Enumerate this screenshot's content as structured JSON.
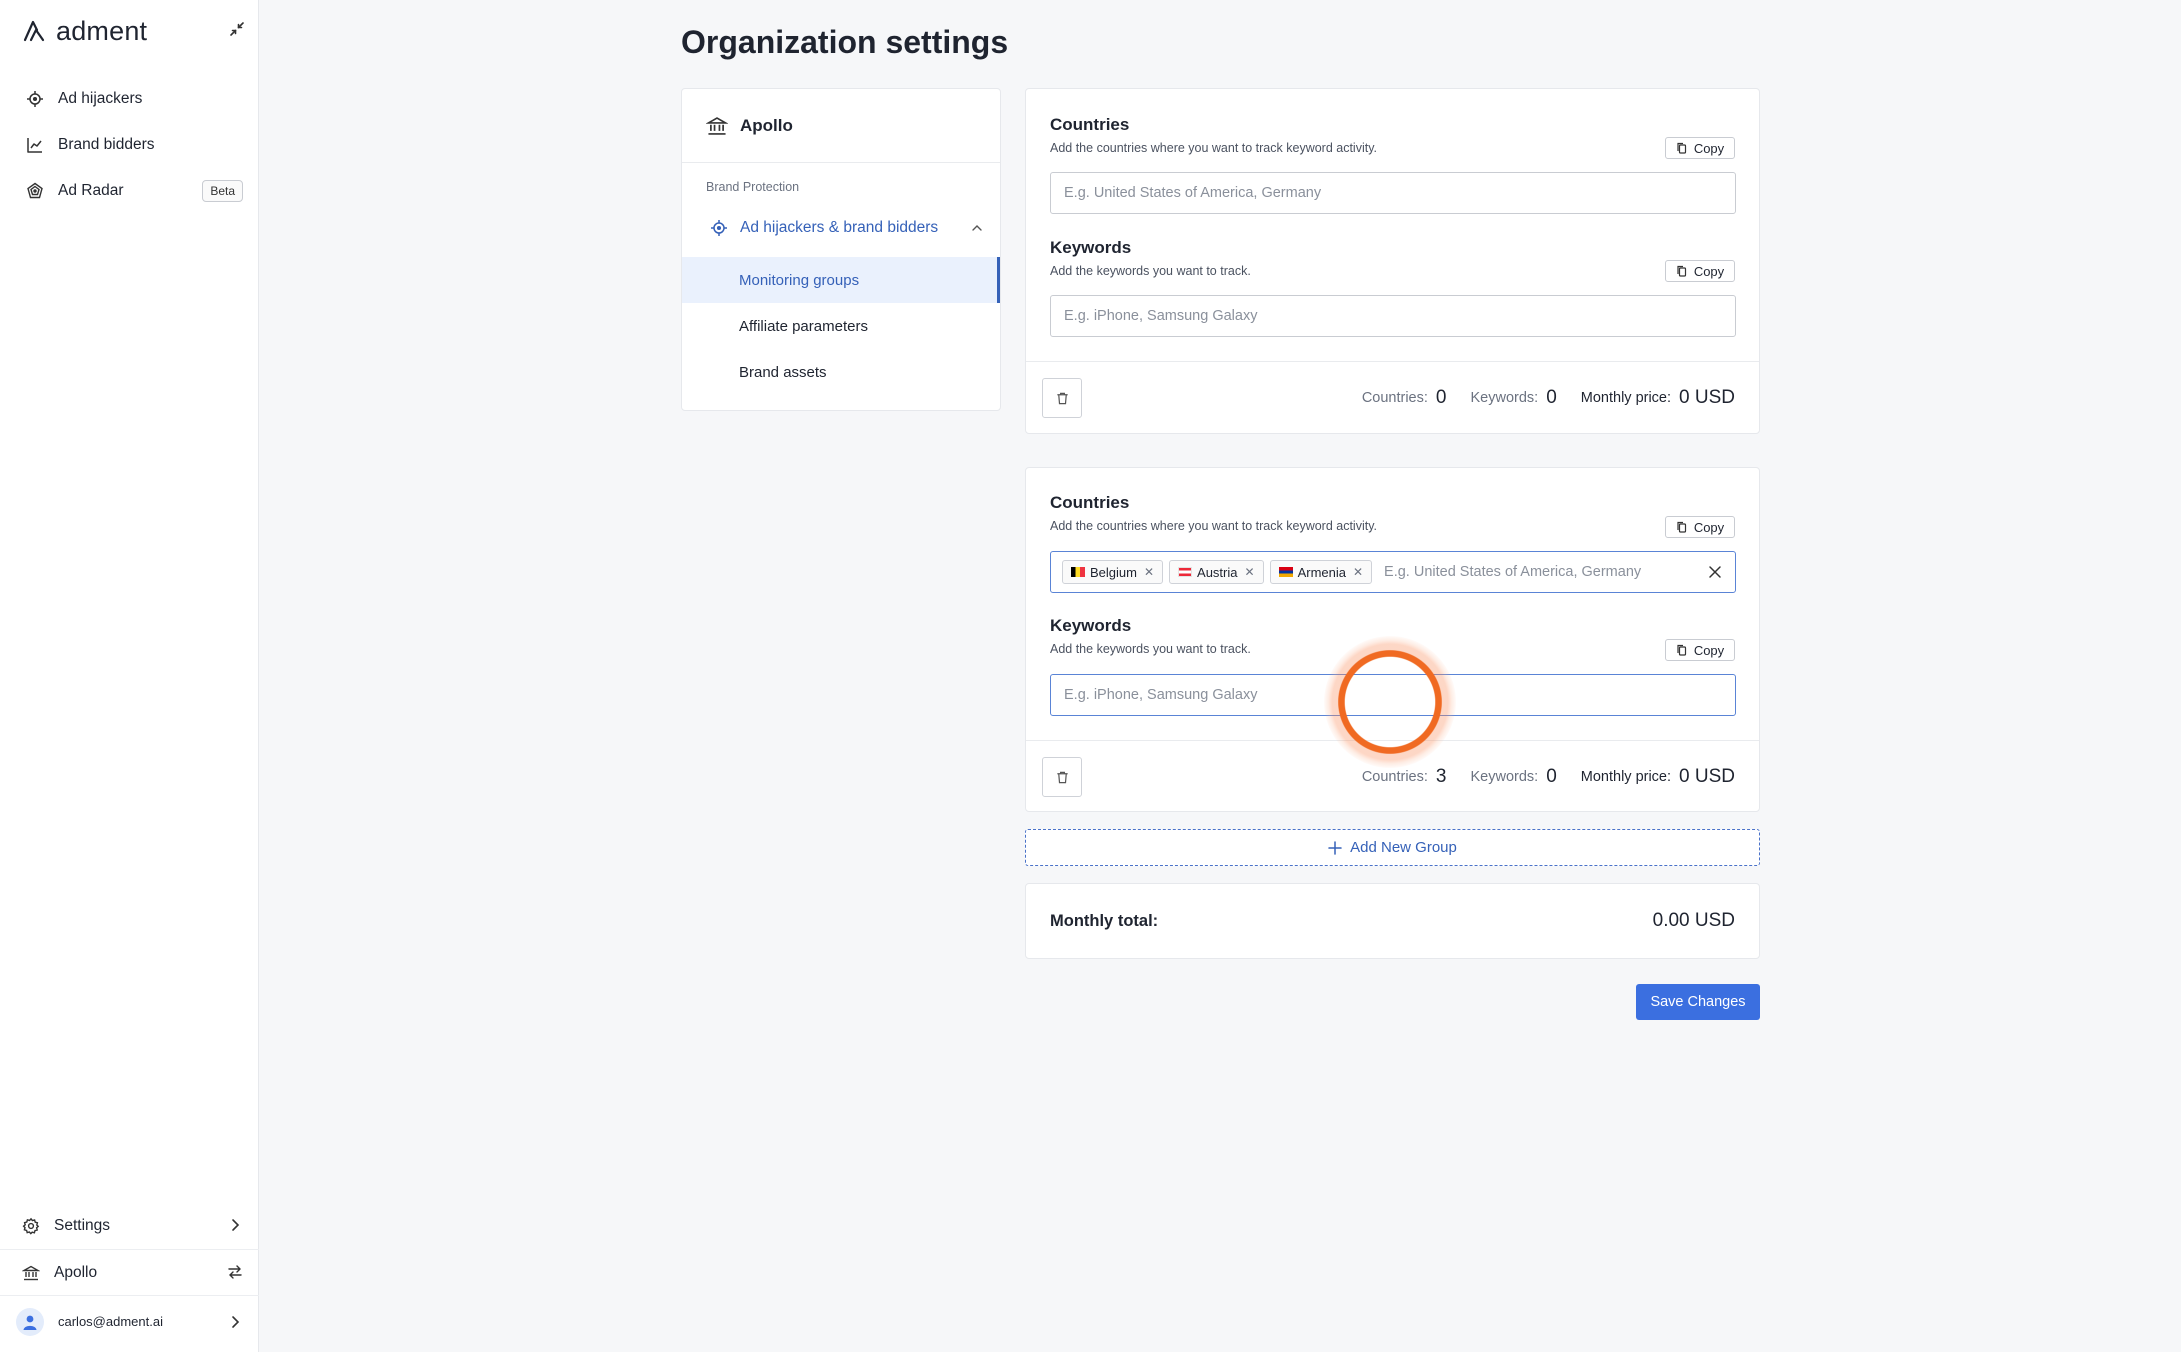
{
  "app": {
    "name": "adment"
  },
  "sidebar": {
    "nav": [
      {
        "label": "Ad hijackers",
        "icon": "crosshair-icon"
      },
      {
        "label": "Brand bidders",
        "icon": "line-chart-icon"
      },
      {
        "label": "Ad Radar",
        "icon": "radar-icon",
        "badge": "Beta"
      }
    ],
    "settings_label": "Settings",
    "org_label": "Apollo",
    "user_email": "carlos@adment.ai"
  },
  "page": {
    "title": "Organization settings"
  },
  "settings_nav": {
    "org_name": "Apollo",
    "section_label": "Brand Protection",
    "parent_item": "Ad hijackers & brand bidders",
    "sub_items": [
      "Monitoring groups",
      "Affiliate parameters",
      "Brand assets"
    ],
    "active_sub_item": "Monitoring groups"
  },
  "groups": [
    {
      "countries_title": "Countries",
      "countries_desc": "Add the countries where you want to track keyword activity.",
      "countries_placeholder": "E.g. United States of America, Germany",
      "countries_value": "",
      "countries_tags": [],
      "keywords_title": "Keywords",
      "keywords_desc": "Add the keywords you want to track.",
      "keywords_placeholder": "E.g. iPhone, Samsung Galaxy",
      "keywords_value": "",
      "copy_label": "Copy",
      "stats": {
        "countries_label": "Countries:",
        "countries": "0",
        "keywords_label": "Keywords:",
        "keywords": "0",
        "price_label": "Monthly price:",
        "price": "0 USD"
      }
    },
    {
      "countries_title": "Countries",
      "countries_desc": "Add the countries where you want to track keyword activity.",
      "countries_placeholder": "E.g. United States of America, Germany",
      "countries_value": "",
      "countries_tags": [
        {
          "label": "Belgium",
          "flag_colors": [
            "#000000",
            "#FDDA24",
            "#EF3340"
          ],
          "flag_orientation": "vertical"
        },
        {
          "label": "Austria",
          "flag_colors": [
            "#ED2939",
            "#FFFFFF",
            "#ED2939"
          ],
          "flag_orientation": "horizontal"
        },
        {
          "label": "Armenia",
          "flag_colors": [
            "#D90012",
            "#0033A0",
            "#F2A800"
          ],
          "flag_orientation": "horizontal"
        }
      ],
      "keywords_title": "Keywords",
      "keywords_desc": "Add the keywords you want to track.",
      "keywords_placeholder": "E.g. iPhone, Samsung Galaxy",
      "keywords_value": "",
      "copy_label": "Copy",
      "stats": {
        "countries_label": "Countries:",
        "countries": "3",
        "keywords_label": "Keywords:",
        "keywords": "0",
        "price_label": "Monthly price:",
        "price": "0 USD"
      }
    }
  ],
  "add_group_label": "Add New Group",
  "total": {
    "label": "Monthly total:",
    "value": "0.00 USD"
  },
  "save_label": "Save Changes",
  "colors": {
    "accent": "#3561B8",
    "primary_button": "#3B6FE0",
    "click_indicator": "#F06A22"
  }
}
